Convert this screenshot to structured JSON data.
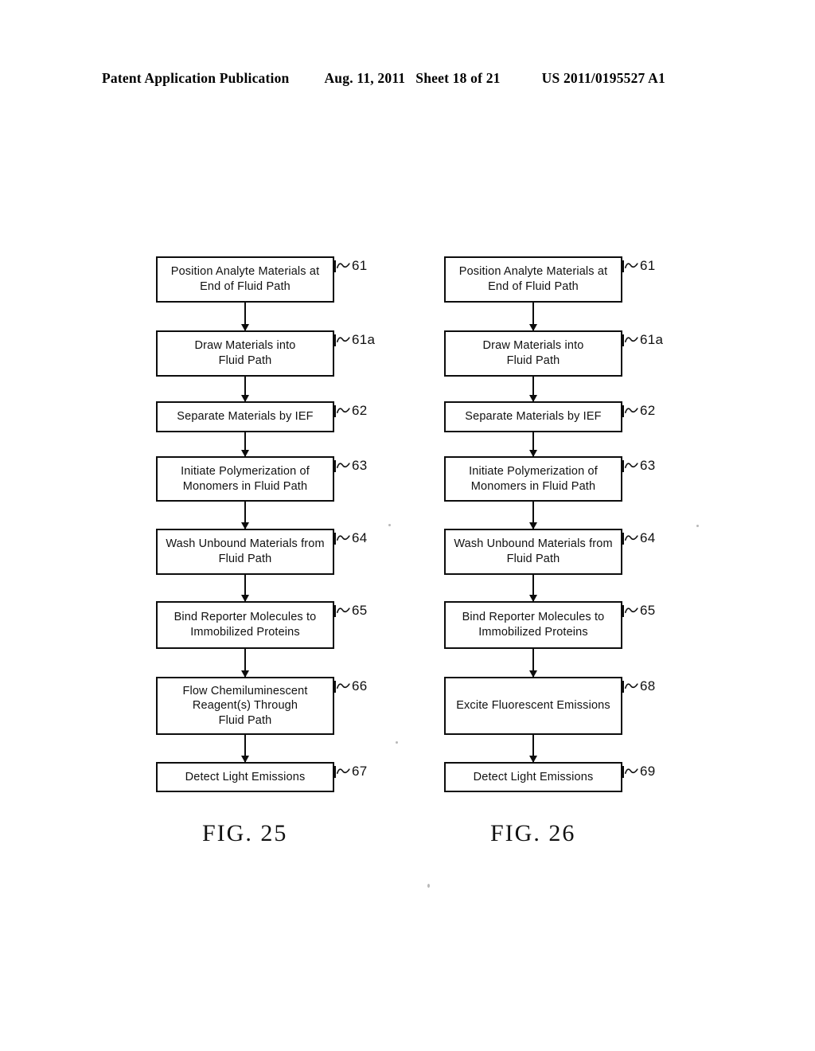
{
  "header": {
    "publication_type": "Patent Application Publication",
    "date": "Aug. 11, 2011",
    "sheet": "Sheet 18 of 21",
    "document_number": "US 2011/0195527 A1"
  },
  "figures": [
    {
      "caption": "FIG. 25",
      "steps": [
        {
          "ref": "61",
          "label": "Position Analyte Materials at\nEnd of Fluid Path",
          "lines": 2
        },
        {
          "ref": "61a",
          "label": "Draw Materials into\nFluid Path",
          "lines": 2
        },
        {
          "ref": "62",
          "label": "Separate Materials by IEF",
          "lines": 1
        },
        {
          "ref": "63",
          "label": "Initiate Polymerization of\nMonomers in Fluid Path",
          "lines": 2
        },
        {
          "ref": "64",
          "label": "Wash Unbound Materials from\nFluid Path",
          "lines": 2
        },
        {
          "ref": "65",
          "label": "Bind Reporter Molecules to\nImmobilized Proteins",
          "lines": 2
        },
        {
          "ref": "66",
          "label": "Flow Chemiluminescent\nReagent(s) Through\nFluid Path",
          "lines": 3
        },
        {
          "ref": "67",
          "label": "Detect Light Emissions",
          "lines": 1
        }
      ]
    },
    {
      "caption": "FIG. 26",
      "steps": [
        {
          "ref": "61",
          "label": "Position Analyte Materials at\nEnd of Fluid Path",
          "lines": 2
        },
        {
          "ref": "61a",
          "label": "Draw Materials into\nFluid Path",
          "lines": 2
        },
        {
          "ref": "62",
          "label": "Separate Materials by IEF",
          "lines": 1
        },
        {
          "ref": "63",
          "label": "Initiate Polymerization of\nMonomers in Fluid Path",
          "lines": 2
        },
        {
          "ref": "64",
          "label": "Wash Unbound Materials from\nFluid Path",
          "lines": 2
        },
        {
          "ref": "65",
          "label": "Bind Reporter Molecules to\nImmobilized Proteins",
          "lines": 2
        },
        {
          "ref": "68",
          "label": "Excite Fluorescent Emissions",
          "lines": 1
        },
        {
          "ref": "69",
          "label": "Detect Light Emissions",
          "lines": 1
        }
      ]
    }
  ],
  "colors": {
    "ink": "#0d0d0d",
    "paper": "#ffffff"
  }
}
